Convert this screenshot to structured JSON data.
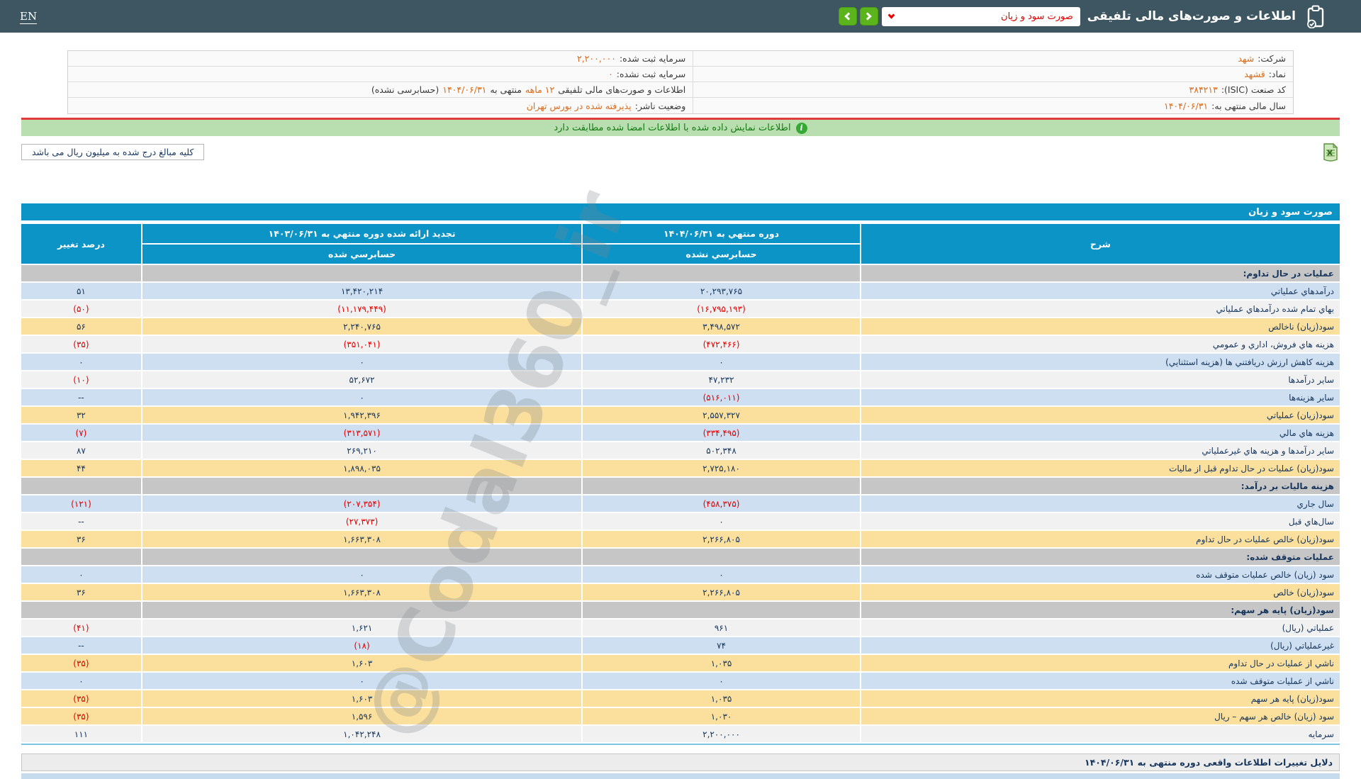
{
  "header": {
    "en_label": "EN",
    "title": "اطلاعات و صورت‌های مالی تلفیقی",
    "select_value": "صورت سود و زیان"
  },
  "info": {
    "company_label": "شرکت:",
    "company_value": "شهد",
    "symbol_label": "نماد:",
    "symbol_value": "قشهد",
    "isic_label": "کد صنعت (ISIC):",
    "isic_value": "۳۸۴۲۱۳",
    "fiscal_label": "سال مالی منتهی به:",
    "fiscal_value": "۱۴۰۴/۰۶/۳۱",
    "registered_capital_label": "سرمایه ثبت شده:",
    "registered_capital_value": "۲,۲۰۰,۰۰۰",
    "unregistered_capital_label": "سرمایه ثبت نشده:",
    "unregistered_capital_value": "۰",
    "report_part1": "اطلاعات و صورت‌های مالی تلفیقی ",
    "report_part2": "۱۲ ماهه",
    "report_part3": "منتهی به",
    "report_part4": "۱۴۰۴/۰۶/۳۱",
    "report_part5": "(حسابرسی نشده)",
    "status_label": "وضعیت ناشر:",
    "status_value": "پذیرفته شده در بورس تهران"
  },
  "banner": {
    "text": "اطلاعات نمایش داده شده با اطلاعات امضا شده مطابقت دارد"
  },
  "note": {
    "text": "کلیه مبالغ درج شده به میلیون ریال می باشد"
  },
  "watermark": "@Codal360_ir",
  "table": {
    "title": "صورت سود و زیان",
    "col_desc": "شرح",
    "col_period_current": "دوره منتهي به ۱۴۰۴/۰۶/۳۱",
    "col_period_prior": "تجدید ارائه شده دوره منتهي به ۱۴۰۳/۰۶/۳۱",
    "col_change": "درصد تغییر",
    "sub_unaudited": "حسابرسي نشده",
    "sub_audited": "حسابرسي شده",
    "rows": [
      {
        "t": "s",
        "l": "عملیات در حال تداوم:"
      },
      {
        "t": "d",
        "v": "blue",
        "l": "درآمدهاي عملياتي",
        "p1": "۲۰,۲۹۳,۷۶۵",
        "p2": "۱۳,۴۲۰,۲۱۴",
        "pc": "۵۱"
      },
      {
        "t": "d",
        "v": "white",
        "l": "بهاي تمام شده درآمدهاي عملياتي",
        "p1": "(۱۶,۷۹۵,۱۹۳)",
        "p2": "(۱۱,۱۷۹,۴۴۹)",
        "pc": "(۵۰)"
      },
      {
        "t": "d",
        "v": "yellow",
        "l": "سود(زيان) ناخالص",
        "p1": "۳,۴۹۸,۵۷۲",
        "p2": "۲,۲۴۰,۷۶۵",
        "pc": "۵۶"
      },
      {
        "t": "d",
        "v": "white",
        "l": "هزينه هاي فروش، اداري و عمومي",
        "p1": "(۴۷۲,۴۶۶)",
        "p2": "(۳۵۱,۰۴۱)",
        "pc": "(۳۵)"
      },
      {
        "t": "d",
        "v": "blue",
        "l": "هزينه كاهش ارزش دريافتني ها (هزينه استثنايي)",
        "p1": "۰",
        "p2": "۰",
        "pc": "۰"
      },
      {
        "t": "d",
        "v": "white",
        "l": "ساير درآمدها",
        "p1": "۴۷,۲۳۲",
        "p2": "۵۲,۶۷۲",
        "pc": "(۱۰)"
      },
      {
        "t": "d",
        "v": "blue",
        "l": "ساير هزينه‌ها",
        "p1": "(۵۱۶,۰۱۱)",
        "p2": "۰",
        "pc": "--"
      },
      {
        "t": "d",
        "v": "yellow",
        "l": "سود(زيان) عملياتي",
        "p1": "۲,۵۵۷,۳۲۷",
        "p2": "۱,۹۴۲,۳۹۶",
        "pc": "۳۲"
      },
      {
        "t": "d",
        "v": "blue",
        "l": "هزينه هاي مالي",
        "p1": "(۳۳۴,۴۹۵)",
        "p2": "(۳۱۳,۵۷۱)",
        "pc": "(۷)"
      },
      {
        "t": "d",
        "v": "white",
        "l": "ساير درآمدها و هزينه هاي غيرعملياتي",
        "p1": "۵۰۲,۳۴۸",
        "p2": "۲۶۹,۲۱۰",
        "pc": "۸۷"
      },
      {
        "t": "d",
        "v": "yellow",
        "l": "سود(زيان) عمليات در حال تداوم قبل از ماليات",
        "p1": "۲,۷۲۵,۱۸۰",
        "p2": "۱,۸۹۸,۰۳۵",
        "pc": "۴۴"
      },
      {
        "t": "s",
        "l": "هزينه ماليات بر درآمد:"
      },
      {
        "t": "d",
        "v": "blue",
        "l": "سال جاري",
        "p1": "(۴۵۸,۳۷۵)",
        "p2": "(۲۰۷,۳۵۴)",
        "pc": "(۱۲۱)"
      },
      {
        "t": "d",
        "v": "white",
        "l": "سال‌هاي قبل",
        "p1": "۰",
        "p2": "(۲۷,۳۷۳)",
        "pc": "--"
      },
      {
        "t": "d",
        "v": "yellow",
        "l": "سود(زيان) خالص عمليات در حال تداوم",
        "p1": "۲,۲۶۶,۸۰۵",
        "p2": "۱,۶۶۳,۳۰۸",
        "pc": "۳۶"
      },
      {
        "t": "s",
        "l": "عمليات متوقف شده:"
      },
      {
        "t": "d",
        "v": "blue",
        "l": "سود (زيان) خالص عمليات متوقف شده",
        "p1": "۰",
        "p2": "۰",
        "pc": "۰"
      },
      {
        "t": "d",
        "v": "yellow",
        "l": "سود(زيان) خالص",
        "p1": "۲,۲۶۶,۸۰۵",
        "p2": "۱,۶۶۳,۳۰۸",
        "pc": "۳۶"
      },
      {
        "t": "s",
        "l": "سود(زيان) پايه هر سهم:"
      },
      {
        "t": "d",
        "v": "white",
        "l": "عملياتي (ريال)",
        "p1": "۹۶۱",
        "p2": "۱,۶۲۱",
        "pc": "(۴۱)"
      },
      {
        "t": "d",
        "v": "blue",
        "l": "غيرعملياتي (ريال)",
        "p1": "۷۴",
        "p2": "(۱۸)",
        "pc": "--"
      },
      {
        "t": "d",
        "v": "yellow",
        "l": "ناشي از عمليات در حال تداوم",
        "p1": "۱,۰۳۵",
        "p2": "۱,۶۰۳",
        "pc": "(۳۵)"
      },
      {
        "t": "d",
        "v": "blue",
        "l": "ناشي از عمليات متوقف شده",
        "p1": "۰",
        "p2": "۰",
        "pc": "۰"
      },
      {
        "t": "d",
        "v": "yellow",
        "l": "سود(زيان) پايه هر سهم",
        "p1": "۱,۰۳۵",
        "p2": "۱,۶۰۳",
        "pc": "(۳۵)"
      },
      {
        "t": "d",
        "v": "yellow",
        "l": "سود (زيان) خالص هر سهم – ريال",
        "p1": "۱,۰۳۰",
        "p2": "۱,۵۹۶",
        "pc": "(۳۵)"
      },
      {
        "t": "d",
        "v": "white",
        "l": "سرمايه",
        "p1": "۲,۲۰۰,۰۰۰",
        "p2": "۱,۰۴۲,۲۴۸",
        "pc": "۱۱۱"
      }
    ]
  },
  "footer": {
    "title": "دلایل تغییرات اطلاعات واقعی دوره منتهی به ۱۴۰۴/۰۶/۳۱"
  },
  "colors": {
    "topbar": "#3e5661",
    "table_header": "#0d94c7",
    "row_blue": "#cddff1",
    "row_yellow": "#fbdf9c",
    "row_section": "#c6c6c6",
    "negative": "#e30000",
    "accent_orange": "#d86c1e",
    "banner_green": "#b9dfb0",
    "button_green": "#5cb41c"
  }
}
